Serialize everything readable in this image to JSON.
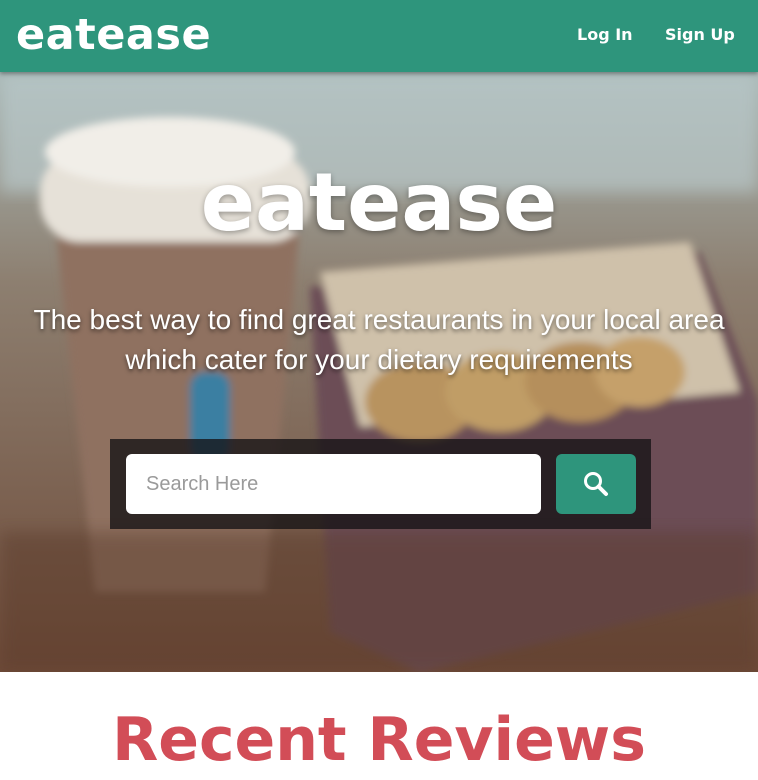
{
  "navbar": {
    "logo": "eatease",
    "links": {
      "login": "Log In",
      "signup": "Sign Up"
    },
    "background_color": "#2e957c"
  },
  "hero": {
    "title": "eatease",
    "tagline": "The best way to find great restaurants in your local area which cater for your dietary requirements",
    "search": {
      "placeholder": "Search Here",
      "value": "",
      "button_icon": "search-icon"
    }
  },
  "sections": {
    "recent_reviews_title": "Recent Reviews"
  },
  "colors": {
    "accent": "#2e957c",
    "heading_red": "#d24d57",
    "text_on_dark": "#ffffff"
  }
}
